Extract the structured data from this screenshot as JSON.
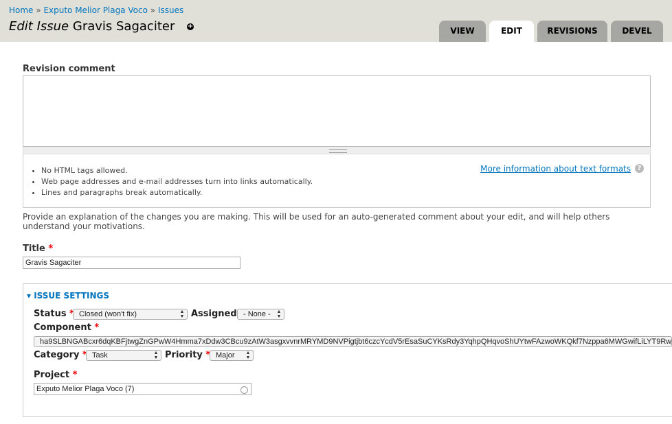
{
  "breadcrumb": {
    "home": "Home",
    "sep": "»",
    "project": "Exputo Melior Plaga Voco",
    "issues": "Issues"
  },
  "page": {
    "title_prefix": "Edit Issue",
    "title_name": "Gravis Sagaciter",
    "plus": "+"
  },
  "tabs": [
    {
      "label": "VIEW",
      "active": false
    },
    {
      "label": "EDIT",
      "active": true
    },
    {
      "label": "REVISIONS",
      "active": false
    },
    {
      "label": "DEVEL",
      "active": false
    }
  ],
  "revision": {
    "label": "Revision comment",
    "value": "",
    "tips": [
      "No HTML tags allowed.",
      "Web page addresses and e-mail addresses turn into links automatically.",
      "Lines and paragraphs break automatically."
    ],
    "more_info": "More information about text formats",
    "help": "?",
    "description": "Provide an explanation of the changes you are making. This will be used for an auto-generated comment about your edit, and will help others understand your motivations."
  },
  "title_field": {
    "label": "Title",
    "required": "*",
    "value": "Gravis Sagaciter"
  },
  "issue_settings": {
    "legend": "ISSUE SETTINGS",
    "status": {
      "label": "Status",
      "required": "*",
      "value": "Closed (won't fix)"
    },
    "assigned": {
      "label": "Assigned",
      "value": "- None -"
    },
    "component": {
      "label": "Component",
      "required": "*",
      "value": "ha9SLBNGABcxr6dqKBFjtwgZnGPwW4Hmma7xDdw3CBcu9zAtW3asgxvvnrMRYMD9NVPigtjbt6czcYcdV5rEsaSuCYKsRdy3YqhpQHqvoShUYtwFAzwoWKQkf7Nzppa6MWGwifLiLYT9Rw"
    },
    "category": {
      "label": "Category",
      "required": "*",
      "value": "Task"
    },
    "priority": {
      "label": "Priority",
      "required": "*",
      "value": "Major"
    },
    "project": {
      "label": "Project",
      "required": "*",
      "value": "Exputo Melior Plaga Voco (7)"
    }
  },
  "colors": {
    "link": "#0074bd",
    "tab_inactive": "#a6a7a2",
    "header_bg": "#e0e0d8",
    "required": "#ee0000"
  }
}
